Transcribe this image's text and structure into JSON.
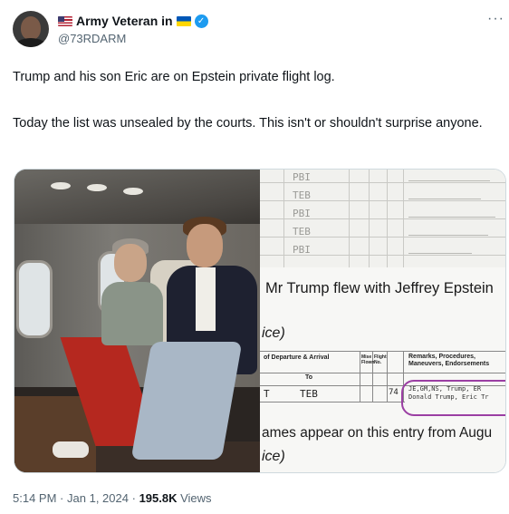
{
  "author": {
    "display_name": "Army Veteran in",
    "handle": "@73RDARM",
    "verified_icon": "verified-check-icon",
    "flag_icons": [
      "us-flag-icon",
      "ukraine-flag-icon"
    ]
  },
  "tweet": {
    "paragraph1": "Trump and his son Eric are on Epstein private flight log.",
    "paragraph2": "Today the list was unsealed by the courts. This isn't or shouldn't surprise anyone."
  },
  "media": {
    "doc": {
      "ledger_rows": [
        "PBI",
        "TEB",
        "PBI",
        "TEB",
        "PBI"
      ],
      "headline": "Mr Trump flew with Jeffrey Epstein",
      "ice_fragment_1": "ice)",
      "table_headers": [
        "of Departure & Arrival",
        "To",
        "Mise Flown",
        "Flight No.",
        "Remarks, Procedures, Maneuvers, Endorsements"
      ],
      "cell_to": "TEB",
      "cell_t": "T",
      "cell_num": "74",
      "remark_line1": "JE,GM,NS, Trump, ER",
      "remark_line2": "Donald Trump, Eric Tr",
      "names_line": "ames appear on this entry from Augu",
      "ice_fragment_2": "ice)"
    }
  },
  "footer": {
    "time": "5:14 PM",
    "separator": "·",
    "date": "Jan 1, 2024",
    "views_count": "195.8K",
    "views_label": "Views"
  },
  "colors": {
    "accent": "#1d9bf0",
    "secondary_text": "#536471",
    "annotation_circle": "#9b3fa3"
  }
}
